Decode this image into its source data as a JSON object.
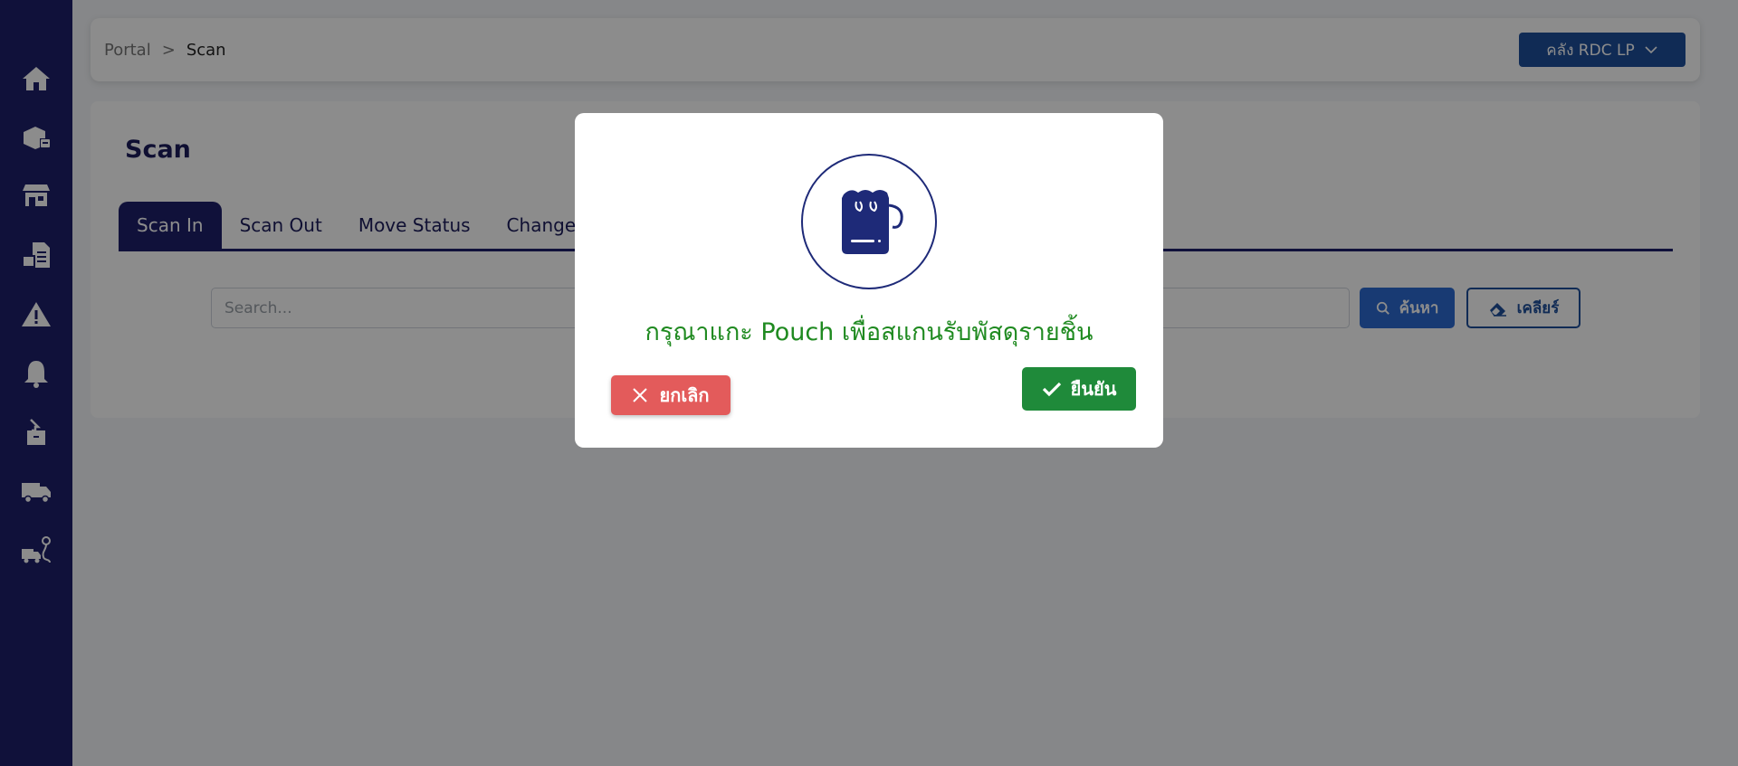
{
  "sidebar": {
    "items": [
      {
        "icon": "home-icon"
      },
      {
        "icon": "package-box-icon"
      },
      {
        "icon": "store-icon"
      },
      {
        "icon": "report-box-icon"
      },
      {
        "icon": "warning-icon"
      },
      {
        "icon": "bell-icon"
      },
      {
        "icon": "tray-down-icon"
      },
      {
        "icon": "truck-icon"
      },
      {
        "icon": "truck-route-icon"
      }
    ]
  },
  "header": {
    "breadcrumb": {
      "root": "Portal",
      "separator": ">",
      "current": "Scan"
    },
    "warehouse_label": "คลัง RDC LP"
  },
  "main": {
    "title": "Scan",
    "tabs": [
      {
        "label": "Scan In",
        "active": true
      },
      {
        "label": "Scan Out",
        "active": false
      },
      {
        "label": "Move Status",
        "active": false
      },
      {
        "label": "Change Custodian",
        "active": false
      }
    ],
    "search": {
      "placeholder": "Search...",
      "value": ""
    },
    "search_button": "ค้นหา",
    "clear_button": "เคลียร์"
  },
  "modal": {
    "icon": "pouch-bag-icon",
    "message": "กรุณาแกะ Pouch เพื่อสแกนรับพัสดุรายชิ้น",
    "cancel_label": "ยกเลิก",
    "confirm_label": "ยืนยัน"
  },
  "colors": {
    "sidebar": "#1e1f6b",
    "primary": "#1e4f9c",
    "confirm": "#1f8a3a",
    "cancel": "#e35b5b",
    "message": "#1f8a20"
  }
}
